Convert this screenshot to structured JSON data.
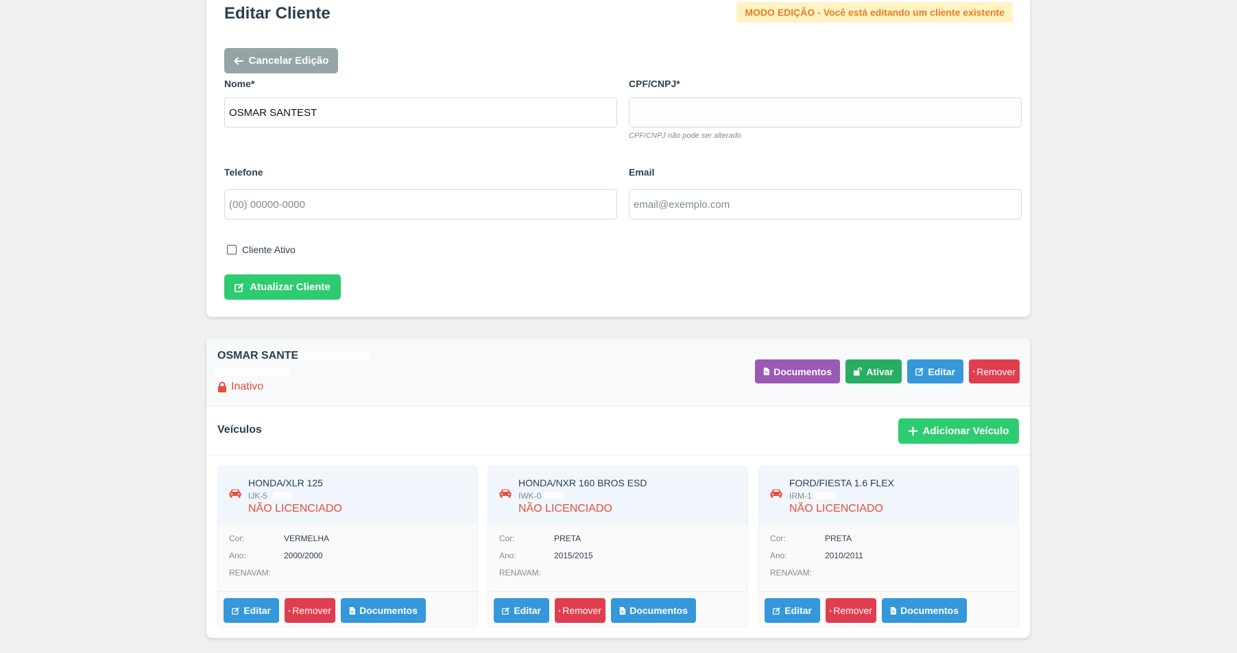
{
  "page": {
    "title": "Editar Cliente",
    "mode_badge": "MODO EDIÇÃO - Você está editando um cliente existente",
    "cancel_label": "Cancelar Edição",
    "update_label": "Atualizar Cliente"
  },
  "form": {
    "nome_label": "Nome*",
    "nome_value": "OSMAR SANTEST",
    "cpf_label": "CPF/CNPJ*",
    "cpf_value": "",
    "cpf_help": "CPF/CNPJ não pode ser alterado",
    "telefone_label": "Telefone",
    "telefone_placeholder": "(00) 00000-0000",
    "email_label": "Email",
    "email_placeholder": "email@exemplo.com",
    "ativo_label": "Cliente Ativo",
    "ativo_checked": false
  },
  "client": {
    "name": "OSMAR SANTES",
    "status": "Inativo",
    "actions": {
      "documentos": "Documentos",
      "ativar": "Ativar",
      "editar": "Editar",
      "remover": "Remover"
    }
  },
  "vehicles_section": {
    "title": "Veículos",
    "add_label": "Adicionar Veículo",
    "field_labels": {
      "cor": "Cor:",
      "ano": "Ano:",
      "renavam": "RENAVAM:"
    },
    "action_labels": {
      "editar": "Editar",
      "remover": "Remover",
      "documentos": "Documentos"
    },
    "items": [
      {
        "model": "HONDA/XLR 125",
        "plate": "IJK-5",
        "status": "NÃO LICENCIADO",
        "cor": "VERMELHA",
        "ano": "2000/2000",
        "renavam": ""
      },
      {
        "model": "HONDA/NXR 160 BROS ESD",
        "plate": "IWK-0",
        "status": "NÃO LICENCIADO",
        "cor": "PRETA",
        "ano": "2015/2015",
        "renavam": ""
      },
      {
        "model": "FORD/FIESTA 1.6 FLEX",
        "plate": "IRM-1",
        "status": "NÃO LICENCIADO",
        "cor": "PRETA",
        "ano": "2010/2011",
        "renavam": ""
      }
    ]
  },
  "colors": {
    "primary_blue": "#3498db",
    "success_green": "#2ecc71",
    "danger_red": "#e03e4f",
    "purple": "#9b59b6",
    "warning_bg": "#fff3c4",
    "warning_text": "#e67e22"
  },
  "icons": {
    "cancel": "arrow-left-icon",
    "update": "edit-icon",
    "lock": "lock-icon",
    "documents": "document-icon",
    "activate": "unlock-icon",
    "edit": "edit-icon",
    "remove": "trash-icon",
    "add": "plus-icon",
    "vehicle": "car-icon"
  }
}
